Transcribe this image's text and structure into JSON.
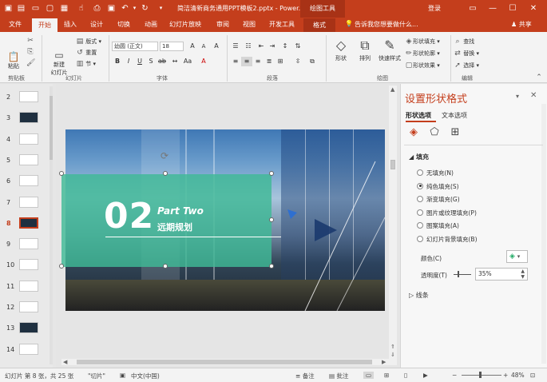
{
  "window": {
    "title": "简洁清新商务通用PPT模板2.pptx  -  Power...",
    "tool_context": "绘图工具",
    "tell_me": "告诉我您想要做什么...",
    "login": "登录",
    "share": "共享"
  },
  "tabs": [
    "文件",
    "开始",
    "插入",
    "设计",
    "切换",
    "动画",
    "幻灯片放映",
    "审阅",
    "视图",
    "开发工具",
    "格式"
  ],
  "ribbon": {
    "clipboard": {
      "paste": "粘贴",
      "label": "剪贴板"
    },
    "slides": {
      "new_slide": "新建",
      "new_slide2": "幻灯片",
      "layout": "版式",
      "reset": "重置",
      "section": "节",
      "label": "幻灯片"
    },
    "font": {
      "name": "幼圆 (正文)",
      "size": "18",
      "label": "字体"
    },
    "paragraph": {
      "label": "段落"
    },
    "drawing": {
      "shapes": "形状",
      "arrange": "排列",
      "quick_styles": "快速样式",
      "fill": "形状填充",
      "outline": "形状轮廓",
      "effect": "形状效果",
      "label": "绘图"
    },
    "editing": {
      "find": "查找",
      "replace": "替换",
      "select": "选择",
      "label": "编辑"
    }
  },
  "thumbnails": [
    {
      "num": "2",
      "dark": false,
      "active": false
    },
    {
      "num": "3",
      "dark": true,
      "active": false
    },
    {
      "num": "4",
      "dark": false,
      "active": false
    },
    {
      "num": "5",
      "dark": false,
      "active": false
    },
    {
      "num": "6",
      "dark": false,
      "active": false
    },
    {
      "num": "7",
      "dark": false,
      "active": false
    },
    {
      "num": "8",
      "dark": true,
      "active": true
    },
    {
      "num": "9",
      "dark": false,
      "active": false
    },
    {
      "num": "10",
      "dark": false,
      "active": false
    },
    {
      "num": "11",
      "dark": false,
      "active": false
    },
    {
      "num": "12",
      "dark": false,
      "active": false
    },
    {
      "num": "13",
      "dark": true,
      "active": false
    },
    {
      "num": "14",
      "dark": false,
      "active": false
    }
  ],
  "slide": {
    "number": "02",
    "part": "Part Two",
    "subtitle": "远期规划",
    "band_color": "#40ba96"
  },
  "pane": {
    "title": "设置形状格式",
    "tab_shape": "形状选项",
    "tab_text": "文本选项",
    "fill_header": "填充",
    "options": [
      {
        "label": "无填充(N)",
        "selected": false
      },
      {
        "label": "纯色填充(S)",
        "selected": true
      },
      {
        "label": "渐变填充(G)",
        "selected": false
      },
      {
        "label": "图片或纹理填充(P)",
        "selected": false
      },
      {
        "label": "图案填充(A)",
        "selected": false
      },
      {
        "label": "幻灯片背景填充(B)",
        "selected": false
      }
    ],
    "color_label": "颜色(C)",
    "transparency_label": "透明度(T)",
    "transparency_value": "35%",
    "line_header": "线条"
  },
  "status": {
    "slide_info": "幻灯片 第 8 张，共 25 张",
    "theme": "\"切片\"",
    "language": "中文(中国)",
    "notes": "备注",
    "comments": "批注",
    "zoom": "48%"
  },
  "colors": {
    "accent": "#c43e1c"
  }
}
